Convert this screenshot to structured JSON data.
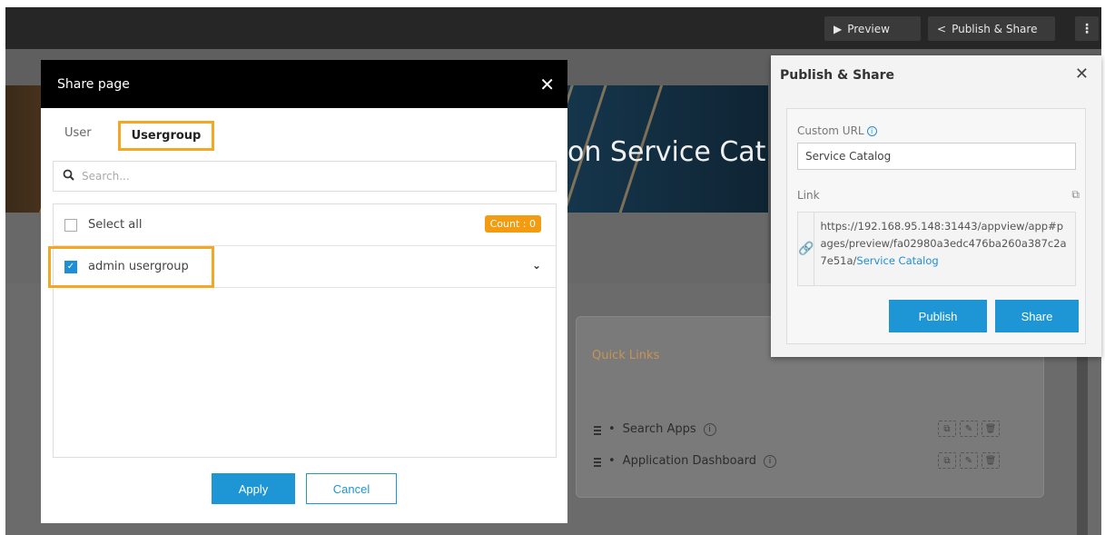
{
  "topbar": {
    "preview_label": "Preview",
    "publish_share_label": "Publish & Share",
    "more_label": "⋮"
  },
  "background": {
    "banner_title_fragment": "on Service Cat",
    "quick_links": {
      "title": "Quick Links",
      "items": [
        {
          "label": "Search Apps"
        },
        {
          "label": "Application Dashboard"
        }
      ]
    }
  },
  "share_dialog": {
    "title": "Share page",
    "tabs": [
      {
        "label": "User",
        "active": false
      },
      {
        "label": "Usergroup",
        "active": true
      }
    ],
    "search_placeholder": "Search...",
    "select_all_label": "Select all",
    "count_badge": "Count : 0",
    "groups": [
      {
        "label": "admin usergroup",
        "checked": true
      }
    ],
    "apply_label": "Apply",
    "cancel_label": "Cancel"
  },
  "publish_panel": {
    "title": "Publish & Share",
    "custom_url_label": "Custom URL",
    "custom_url_value": "Service Catalog",
    "link_label": "Link",
    "link_prefix": "https://192.168.95.148:31443/appview/app#pages/preview/fa02980a3edc476ba260a387c2a7e51a/",
    "link_highlight": "Service Catalog",
    "publish_label": "Publish",
    "share_label": "Share"
  },
  "colors": {
    "accent_blue": "#1e96d6",
    "highlight_orange": "#f5a623",
    "badge_orange": "#f39c12",
    "topbar_bg": "#262626"
  }
}
